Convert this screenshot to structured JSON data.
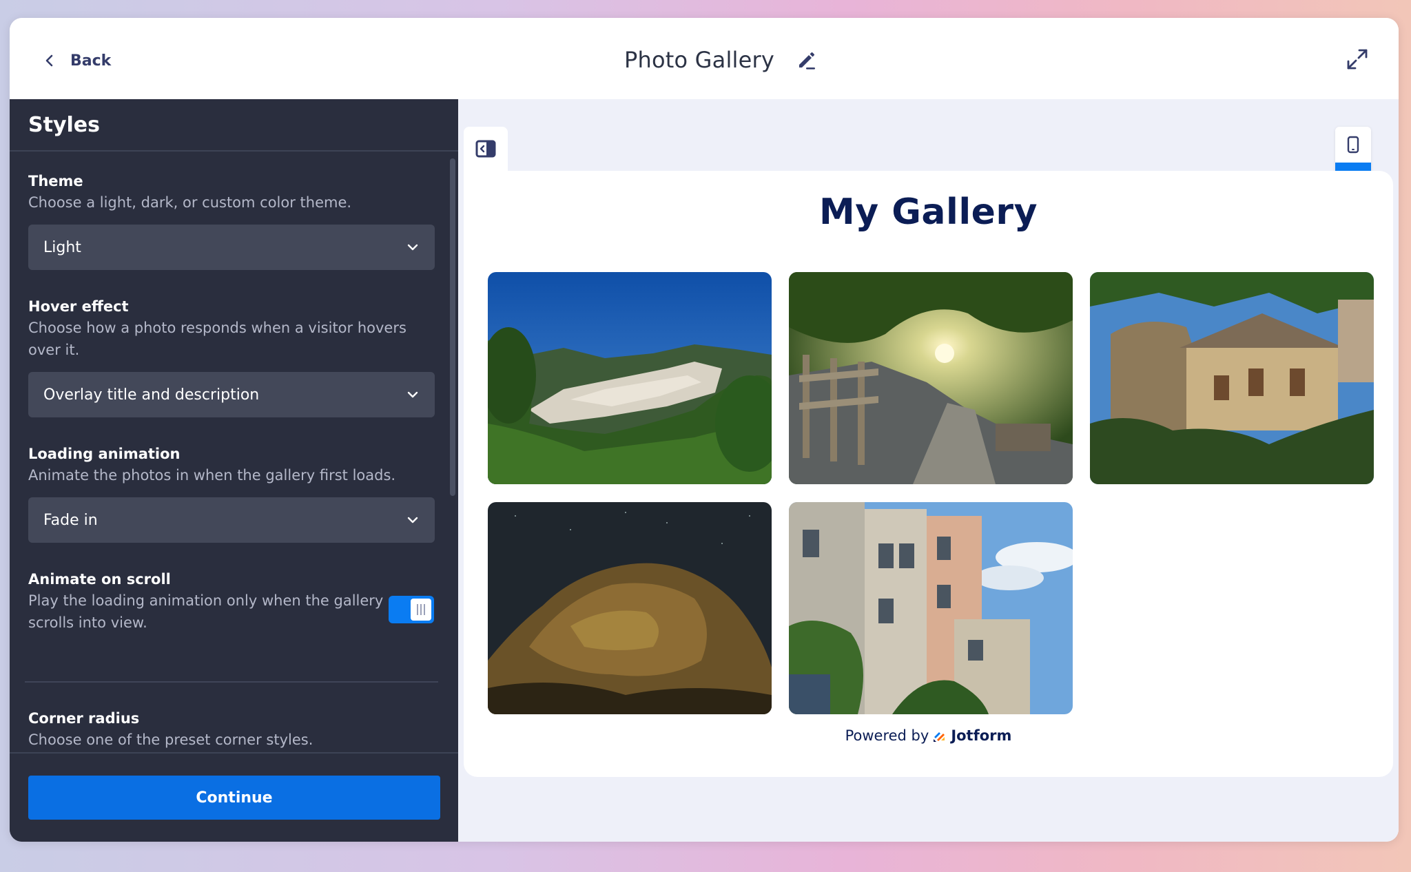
{
  "header": {
    "back_label": "Back",
    "title": "Photo Gallery"
  },
  "panel": {
    "heading": "Styles",
    "theme": {
      "title": "Theme",
      "description": "Choose a light, dark, or custom color theme.",
      "value": "Light"
    },
    "hover": {
      "title": "Hover effect",
      "description": "Choose how a photo responds when a visitor hovers over it.",
      "value": "Overlay title and description"
    },
    "loading": {
      "title": "Loading animation",
      "description": "Animate the photos in when the gallery first loads.",
      "value": "Fade in"
    },
    "animate_scroll": {
      "title": "Animate on scroll",
      "description": "Play the loading animation only when the gallery scrolls into view.",
      "enabled": true
    },
    "corner_radius": {
      "title": "Corner radius",
      "description": "Choose one of the preset corner styles.",
      "selected_index": 1
    },
    "continue_label": "Continue"
  },
  "preview": {
    "gallery_title": "My Gallery",
    "photos": [
      {
        "subject": "hillside village"
      },
      {
        "subject": "sunlit path with fence"
      },
      {
        "subject": "old stone house"
      },
      {
        "subject": "rock under night sky"
      },
      {
        "subject": "apartment buildings"
      }
    ],
    "active_device": "desktop",
    "powered_by": "Powered by",
    "brand": "Jotform"
  },
  "colors": {
    "accent": "#0a7cf2",
    "panel_bg": "#2a2e3e",
    "title_navy": "#0b1d55"
  },
  "icons": {
    "back": "chevron-left-icon",
    "edit": "pencil-icon",
    "expand": "expand-arrows-icon",
    "dropdown": "chevron-down-icon",
    "side_toggle": "panel-toggle-icon",
    "mobile": "mobile-icon",
    "desktop": "desktop-icon"
  }
}
